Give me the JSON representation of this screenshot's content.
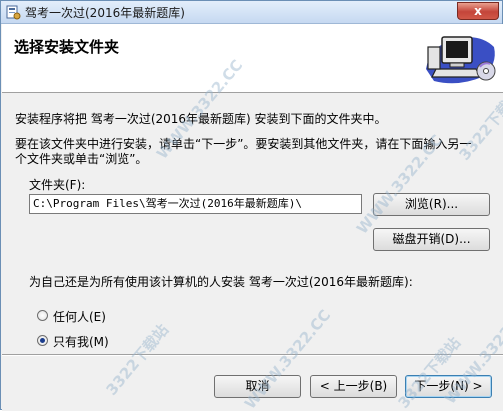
{
  "window": {
    "title": "驾考一次过(2016年最新题库)",
    "close_glyph": "x"
  },
  "header": {
    "title": "选择安装文件夹",
    "art_icon": "computer-cd-icon"
  },
  "body": {
    "intro_line": "安装程序将把 驾考一次过(2016年最新题库) 安装到下面的文件夹中。",
    "instruction_line1": "要在该文件夹中进行安装，请单击“下一步”。要安装到其他文件夹，请在下面输入另一",
    "instruction_line2": "个文件夹或单击“浏览”。",
    "folder_label": "文件夹(F):",
    "folder_value": "C:\\Program Files\\驾考一次过(2016年最新题库)\\",
    "browse_button": "浏览(R)...",
    "disk_cost_button": "磁盘开销(D)...",
    "install_for_label": "为自己还是为所有使用该计算机的人安装 驾考一次过(2016年最新题库):",
    "radio_everyone": {
      "label": "任何人(E)",
      "selected": false
    },
    "radio_just_me": {
      "label": "只有我(M)",
      "selected": true
    }
  },
  "footer": {
    "cancel_button": "取消",
    "back_button": "< 上一步(B)",
    "next_button": "下一步(N) >"
  },
  "watermarks": [
    "WWW.3322.CC",
    "3322下载站",
    "WWW.3322.CC",
    "3322下载站",
    "WWW.3322.CC",
    "3322下载站",
    "WWW.3322.CC"
  ]
}
